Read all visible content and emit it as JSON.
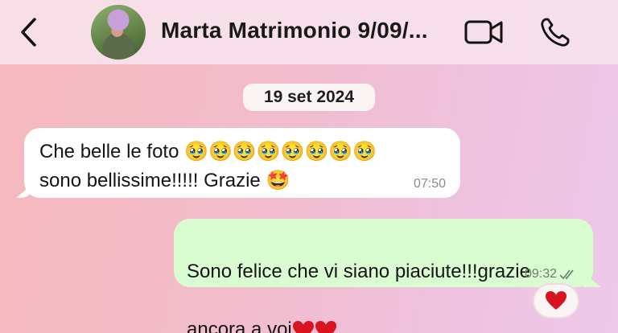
{
  "header": {
    "title": "Marta Matrimonio 9/09/...",
    "avatar_alt": "contact avatar"
  },
  "chat": {
    "date_separator": "19 set 2024",
    "messages": [
      {
        "direction": "incoming",
        "text": "Che belle le foto 🥹🥹🥹🥹🥹🥹🥹🥹\nsono bellissime!!!!! Grazie 🤩",
        "time": "07:50"
      },
      {
        "direction": "outgoing",
        "text_line1": "Sono felice che vi siano piaciute!!!grazie",
        "text_line2": "ancora a voi",
        "time": "09:32",
        "status": "read",
        "reaction": "heart"
      }
    ]
  },
  "colors": {
    "incoming_bubble": "#ffffff",
    "outgoing_bubble": "#d9fdd0",
    "heart": "#d8141f"
  }
}
